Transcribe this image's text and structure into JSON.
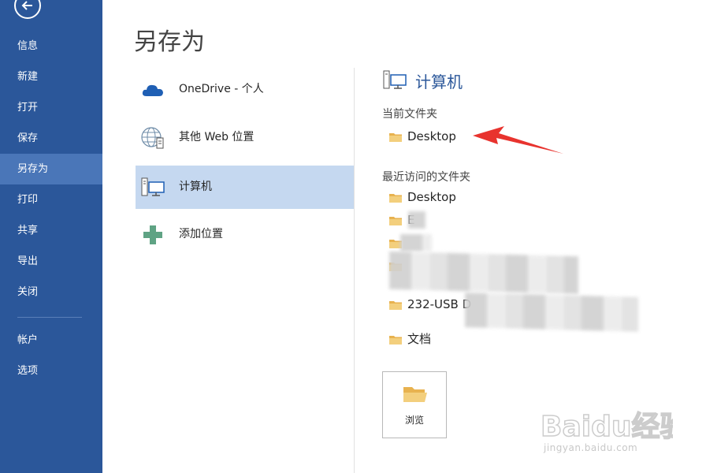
{
  "nav": {
    "items": [
      {
        "label": "信息"
      },
      {
        "label": "新建"
      },
      {
        "label": "打开"
      },
      {
        "label": "保存"
      },
      {
        "label": "另存为",
        "active": true
      },
      {
        "label": "打印"
      },
      {
        "label": "共享"
      },
      {
        "label": "导出"
      },
      {
        "label": "关闭"
      },
      {
        "label": "帐户"
      },
      {
        "label": "选项"
      }
    ]
  },
  "page": {
    "title": "另存为"
  },
  "places": [
    {
      "label": "OneDrive - 个人",
      "icon": "onedrive-cloud-icon"
    },
    {
      "label": "其他 Web 位置",
      "icon": "web-globe-icon"
    },
    {
      "label": "计算机",
      "icon": "computer-icon",
      "selected": true
    },
    {
      "label": "添加位置",
      "icon": "add-plus-icon"
    }
  ],
  "pane": {
    "title": "计算机",
    "current_label": "当前文件夹",
    "current_folder": "Desktop",
    "recent_label": "最近访问的文件夹",
    "recent": [
      "Desktop",
      "E",
      "",
      "",
      "232-USB D",
      "文档"
    ],
    "browse_label": "浏览"
  },
  "watermark": {
    "text": "Baidu经验",
    "url": "jingyan.baidu.com"
  },
  "colors": {
    "nav_bg": "#2b579a",
    "nav_active": "#4a76b8",
    "selected_place": "#c5d8f0",
    "accent": "#2b579a",
    "arrow": "#e8332e",
    "folder": "#e8b24f"
  }
}
